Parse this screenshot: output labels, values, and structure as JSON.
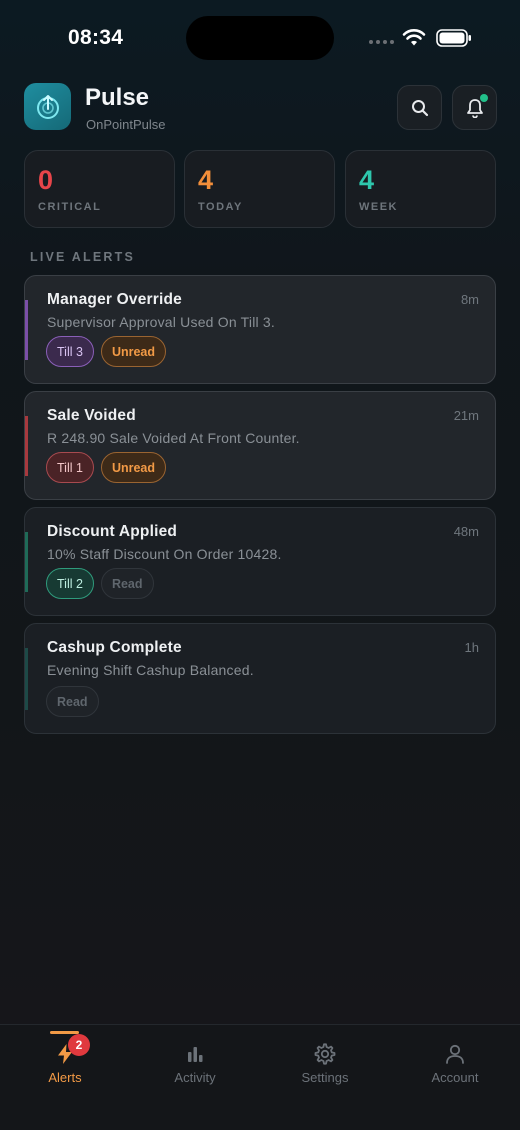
{
  "status_bar": {
    "time": "08:34"
  },
  "header": {
    "title": "Pulse",
    "subtitle": "OnPointPulse",
    "logo_icon": "pulse-logo-icon",
    "search_icon": "search-icon",
    "bell_icon": "bell-icon",
    "notification_dot_color": "#22c08a"
  },
  "stats": [
    {
      "value": "0",
      "label": "CRITICAL",
      "color": "#e8454a"
    },
    {
      "value": "4",
      "label": "TODAY",
      "color": "#f28e3a"
    },
    {
      "value": "4",
      "label": "WEEK",
      "color": "#2ec7ad"
    }
  ],
  "section_label": "LIVE ALERTS",
  "alerts": [
    {
      "title": "Manager Override",
      "time": "8m",
      "description": "Supervisor Approval Used On Till 3.",
      "till": "Till 3",
      "status": "Unread",
      "accent": "#7b4fa8"
    },
    {
      "title": "Sale Voided",
      "time": "21m",
      "description": "R 248.90 Sale Voided At Front Counter.",
      "till": "Till 1",
      "status": "Unread",
      "accent": "#a8393e"
    },
    {
      "title": "Discount Applied",
      "time": "48m",
      "description": "10% Staff Discount On Order 10428.",
      "till": "Till 2",
      "status": "Read",
      "accent": "#1f6b58"
    },
    {
      "title": "Cashup Complete",
      "time": "1h",
      "description": "Evening Shift Cashup Balanced.",
      "till": "",
      "status": "Read",
      "accent": "#1d4a47"
    }
  ],
  "tabs": [
    {
      "label": "Alerts",
      "icon": "bolt-icon",
      "active": true,
      "badge": "2"
    },
    {
      "label": "Activity",
      "icon": "bar-chart-icon",
      "active": false
    },
    {
      "label": "Settings",
      "icon": "gear-icon",
      "active": false
    },
    {
      "label": "Account",
      "icon": "user-icon",
      "active": false
    }
  ],
  "colors": {
    "accent_orange": "#f29a46",
    "badge_red": "#e0393e"
  }
}
